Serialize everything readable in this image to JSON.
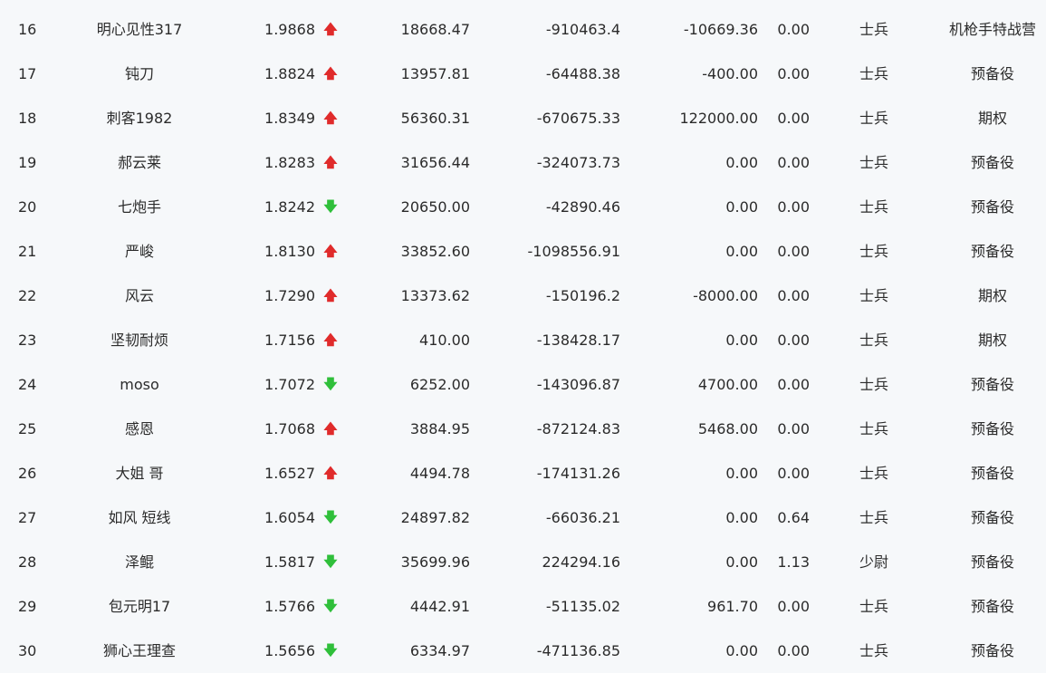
{
  "colors": {
    "up": "#e02b2b",
    "down": "#2fbf3a",
    "background": "#f6f8fa",
    "text": "#2b2b2b"
  },
  "rows": [
    {
      "rank": "16",
      "name": "明心见性317",
      "score": "1.9868",
      "trend": "up",
      "col_a": "18668.47",
      "col_b": "-910463.4",
      "col_c": "-10669.36",
      "col_d": "0.00",
      "title": "士兵",
      "group": "机枪手特战营"
    },
    {
      "rank": "17",
      "name": "钝刀",
      "score": "1.8824",
      "trend": "up",
      "col_a": "13957.81",
      "col_b": "-64488.38",
      "col_c": "-400.00",
      "col_d": "0.00",
      "title": "士兵",
      "group": "预备役"
    },
    {
      "rank": "18",
      "name": "刺客1982",
      "score": "1.8349",
      "trend": "up",
      "col_a": "56360.31",
      "col_b": "-670675.33",
      "col_c": "122000.00",
      "col_d": "0.00",
      "title": "士兵",
      "group": "期权"
    },
    {
      "rank": "19",
      "name": "郝云莱",
      "score": "1.8283",
      "trend": "up",
      "col_a": "31656.44",
      "col_b": "-324073.73",
      "col_c": "0.00",
      "col_d": "0.00",
      "title": "士兵",
      "group": "预备役"
    },
    {
      "rank": "20",
      "name": "七炮手",
      "score": "1.8242",
      "trend": "down",
      "col_a": "20650.00",
      "col_b": "-42890.46",
      "col_c": "0.00",
      "col_d": "0.00",
      "title": "士兵",
      "group": "预备役"
    },
    {
      "rank": "21",
      "name": "严峻",
      "score": "1.8130",
      "trend": "up",
      "col_a": "33852.60",
      "col_b": "-1098556.91",
      "col_c": "0.00",
      "col_d": "0.00",
      "title": "士兵",
      "group": "预备役"
    },
    {
      "rank": "22",
      "name": "风云",
      "score": "1.7290",
      "trend": "up",
      "col_a": "13373.62",
      "col_b": "-150196.2",
      "col_c": "-8000.00",
      "col_d": "0.00",
      "title": "士兵",
      "group": "期权"
    },
    {
      "rank": "23",
      "name": "坚韧耐烦",
      "score": "1.7156",
      "trend": "up",
      "col_a": "410.00",
      "col_b": "-138428.17",
      "col_c": "0.00",
      "col_d": "0.00",
      "title": "士兵",
      "group": "期权"
    },
    {
      "rank": "24",
      "name": "moso",
      "score": "1.7072",
      "trend": "down",
      "col_a": "6252.00",
      "col_b": "-143096.87",
      "col_c": "4700.00",
      "col_d": "0.00",
      "title": "士兵",
      "group": "预备役"
    },
    {
      "rank": "25",
      "name": "感恩",
      "score": "1.7068",
      "trend": "up",
      "col_a": "3884.95",
      "col_b": "-872124.83",
      "col_c": "5468.00",
      "col_d": "0.00",
      "title": "士兵",
      "group": "预备役"
    },
    {
      "rank": "26",
      "name": "大姐 哥",
      "score": "1.6527",
      "trend": "up",
      "col_a": "4494.78",
      "col_b": "-174131.26",
      "col_c": "0.00",
      "col_d": "0.00",
      "title": "士兵",
      "group": "预备役"
    },
    {
      "rank": "27",
      "name": "如风 短线",
      "score": "1.6054",
      "trend": "down",
      "col_a": "24897.82",
      "col_b": "-66036.21",
      "col_c": "0.00",
      "col_d": "0.64",
      "title": "士兵",
      "group": "预备役"
    },
    {
      "rank": "28",
      "name": "泽鲲",
      "score": "1.5817",
      "trend": "down",
      "col_a": "35699.96",
      "col_b": "224294.16",
      "col_c": "0.00",
      "col_d": "1.13",
      "title": "少尉",
      "group": "预备役"
    },
    {
      "rank": "29",
      "name": "包元明17",
      "score": "1.5766",
      "trend": "down",
      "col_a": "4442.91",
      "col_b": "-51135.02",
      "col_c": "961.70",
      "col_d": "0.00",
      "title": "士兵",
      "group": "预备役"
    },
    {
      "rank": "30",
      "name": "狮心王理查",
      "score": "1.5656",
      "trend": "down",
      "col_a": "6334.97",
      "col_b": "-471136.85",
      "col_c": "0.00",
      "col_d": "0.00",
      "title": "士兵",
      "group": "预备役"
    }
  ]
}
